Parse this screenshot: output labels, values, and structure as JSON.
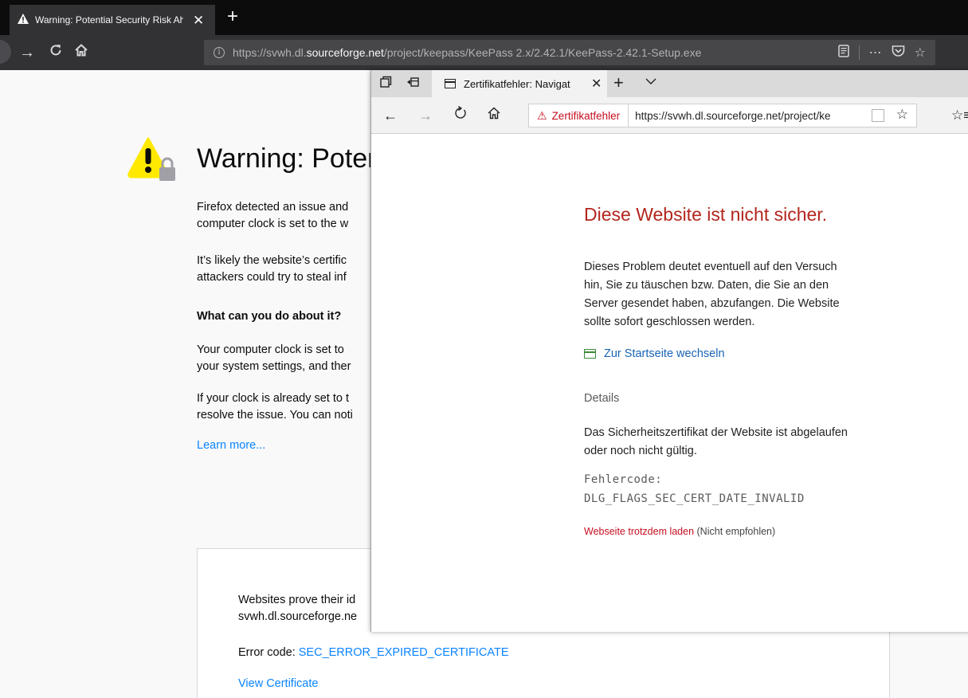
{
  "firefox": {
    "tab": {
      "title": "Warning: Potential Security Risk Ahead"
    },
    "url": {
      "prefix": "https://svwh.dl.",
      "domain": "sourceforge.net",
      "path": "/project/keepass/KeePass 2.x/2.42.1/KeePass-2.42.1-Setup.exe"
    },
    "page": {
      "heading": "Warning: Poter",
      "para1_line1": "Firefox detected an issue and",
      "para1_line2": "computer clock is set to the w",
      "para2_line1": "It’s likely the website’s certific",
      "para2_line2": "attackers could try to steal inf",
      "subheading": "What can you do about it?",
      "para3_line1": "Your computer clock is set to ",
      "para3_line2": "your system settings, and ther",
      "para4_line1": "If your clock is already set to t",
      "para4_line2": "resolve the issue. You can noti",
      "learn_more": "Learn more...",
      "advanced_line1": "Websites prove their id",
      "advanced_line2": "svwh.dl.sourceforge.ne",
      "error_code_label": "Error code: ",
      "error_code": "SEC_ERROR_EXPIRED_CERTIFICATE",
      "view_certificate": "View Certificate"
    }
  },
  "edge": {
    "tab": {
      "title": "Zertifikatfehler: Navigat"
    },
    "address": {
      "warning": "Zertifikatfehler",
      "url": "https://svwh.dl.sourceforge.net/project/ke"
    },
    "page": {
      "heading": "Diese Website ist nicht sicher.",
      "para1_line1": "Dieses Problem deutet eventuell auf den Versuch",
      "para1_line2": "hin, Sie zu täuschen bzw. Daten, die Sie an den",
      "para1_line3": "Server gesendet haben, abzufangen. Die Website",
      "para1_line4": "sollte sofort geschlossen werden.",
      "home_link": "Zur Startseite wechseln",
      "details": "Details",
      "details_line1": "Das Sicherheitszertifikat der Website ist abgelaufen",
      "details_line2": "oder noch nicht gültig.",
      "error_label": "Fehlercode:",
      "error_code": "DLG_FLAGS_SEC_CERT_DATE_INVALID",
      "load_anyway": "Webseite trotzdem laden",
      "load_note": " (Nicht empfohlen)"
    }
  },
  "colors": {
    "edge_warning_red": "#c50f1f",
    "ff_link_blue": "#0a84ff",
    "edge_link_blue": "#1a64b4"
  }
}
